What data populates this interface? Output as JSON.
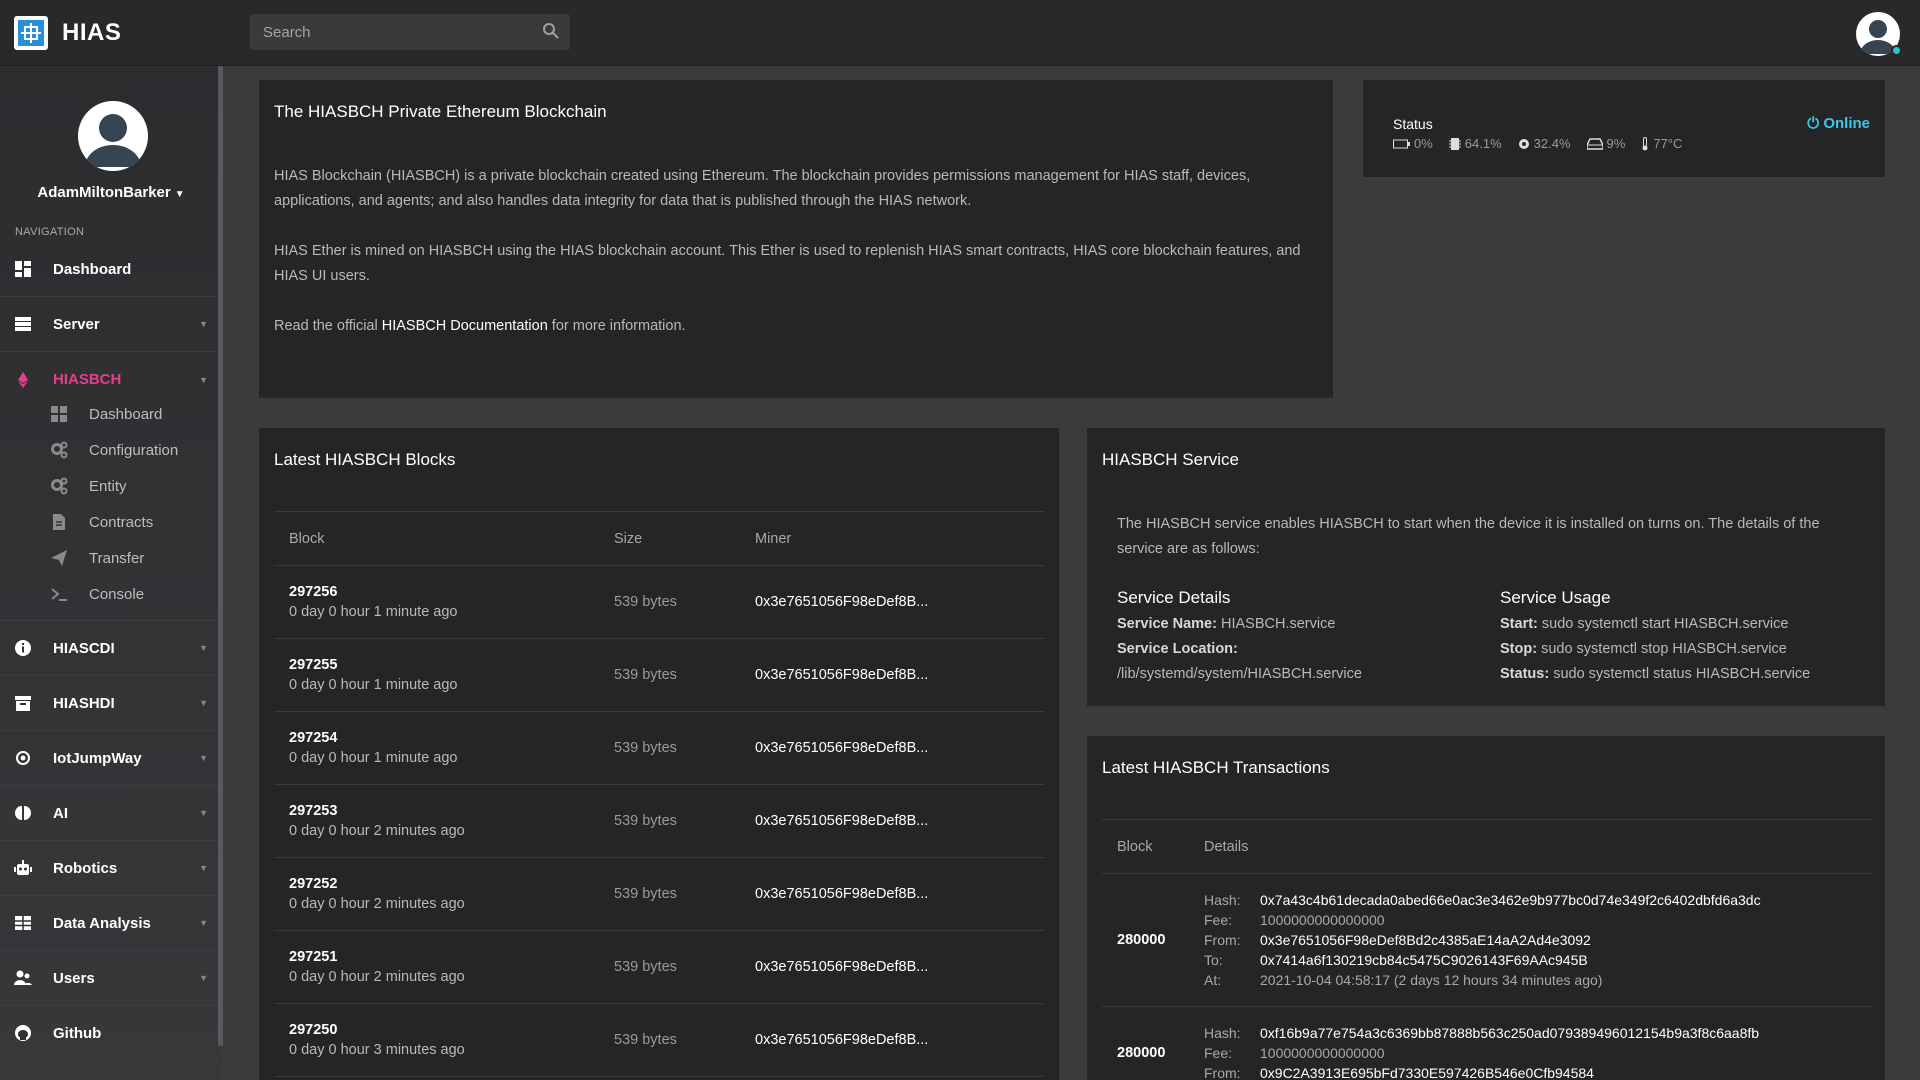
{
  "app": {
    "title": "HIAS"
  },
  "search": {
    "placeholder": "Search"
  },
  "profile": {
    "name": "AdamMiltonBarker"
  },
  "sidebar": {
    "heading": "NAVIGATION",
    "items": [
      {
        "label": "Dashboard",
        "icon": "dashboard-icon"
      },
      {
        "label": "Server",
        "icon": "server-icon"
      },
      {
        "label": "HIASBCH",
        "icon": "ethereum-icon"
      },
      {
        "label": "HIASCDI",
        "icon": "info-icon"
      },
      {
        "label": "HIASHDI",
        "icon": "archive-icon"
      },
      {
        "label": "IotJumpWay",
        "icon": "iot-icon"
      },
      {
        "label": "AI",
        "icon": "brain-icon"
      },
      {
        "label": "Robotics",
        "icon": "robot-icon"
      },
      {
        "label": "Data Analysis",
        "icon": "table-icon"
      },
      {
        "label": "Users",
        "icon": "users-icon"
      },
      {
        "label": "Github",
        "icon": "github-icon"
      }
    ],
    "hiasbch_sub": [
      {
        "label": "Dashboard",
        "icon": "dashboard-icon"
      },
      {
        "label": "Configuration",
        "icon": "cogs-icon"
      },
      {
        "label": "Entity",
        "icon": "cogs-icon"
      },
      {
        "label": "Contracts",
        "icon": "file-icon"
      },
      {
        "label": "Transfer",
        "icon": "send-icon"
      },
      {
        "label": "Console",
        "icon": "terminal-icon"
      }
    ]
  },
  "intro": {
    "title": "The HIASBCH Private Ethereum Blockchain",
    "p1": "HIAS Blockchain (HIASBCH) is a private blockchain created using Ethereum. The blockchain provides permissions management for HIAS staff, devices, applications, and agents; and also handles data integrity for data that is published through the HIAS network.",
    "p2": "HIAS Ether is mined on HIASBCH using the HIAS blockchain account. This Ether is used to replenish HIAS smart contracts, HIAS core blockchain features, and HIAS UI users.",
    "p3_pre": "Read the official ",
    "p3_link": "HIASBCH Documentation",
    "p3_post": " for more information."
  },
  "status": {
    "label": "Status",
    "online": "Online",
    "battery": "0%",
    "cpu": "64.1%",
    "memory": "32.4%",
    "disk": "9%",
    "temp": "77°C"
  },
  "blocks": {
    "title": "Latest HIASBCH Blocks",
    "headers": [
      "Block",
      "Size",
      "Miner"
    ],
    "rows": [
      {
        "block": "297256",
        "ago": "0 day 0 hour 1 minute ago",
        "size": "539 bytes",
        "miner": "0x3e7651056F98eDef8B..."
      },
      {
        "block": "297255",
        "ago": "0 day 0 hour 1 minute ago",
        "size": "539 bytes",
        "miner": "0x3e7651056F98eDef8B..."
      },
      {
        "block": "297254",
        "ago": "0 day 0 hour 1 minute ago",
        "size": "539 bytes",
        "miner": "0x3e7651056F98eDef8B..."
      },
      {
        "block": "297253",
        "ago": "0 day 0 hour 2 minutes ago",
        "size": "539 bytes",
        "miner": "0x3e7651056F98eDef8B..."
      },
      {
        "block": "297252",
        "ago": "0 day 0 hour 2 minutes ago",
        "size": "539 bytes",
        "miner": "0x3e7651056F98eDef8B..."
      },
      {
        "block": "297251",
        "ago": "0 day 0 hour 2 minutes ago",
        "size": "539 bytes",
        "miner": "0x3e7651056F98eDef8B..."
      },
      {
        "block": "297250",
        "ago": "0 day 0 hour 3 minutes ago",
        "size": "539 bytes",
        "miner": "0x3e7651056F98eDef8B..."
      }
    ]
  },
  "service": {
    "title": "HIASBCH Service",
    "desc": "The HIASBCH service enables HIASBCH to start when the device it is installed on turns on. The details of the service are as follows:",
    "details_title": "Service Details",
    "name_key": "Service Name:",
    "name_val": "HIASBCH.service",
    "location_key": "Service Location:",
    "location_val": "/lib/systemd/system/HIASBCH.service",
    "usage_title": "Service Usage",
    "start_key": "Start:",
    "start_val": "sudo systemctl start HIASBCH.service",
    "stop_key": "Stop:",
    "stop_val": "sudo systemctl stop HIASBCH.service",
    "status_key": "Status:",
    "status_val": "sudo systemctl status HIASBCH.service"
  },
  "transactions": {
    "title": "Latest HIASBCH Transactions",
    "headers": [
      "Block",
      "Details"
    ],
    "labels": {
      "hash": "Hash:",
      "fee": "Fee:",
      "from": "From:",
      "to": "To:",
      "at": "At:"
    },
    "rows": [
      {
        "block": "280000",
        "hash": "0x7a43c4b61decada0abed66e0ac3e3462e9b977bc0d74e349f2c6402dbfd6a3dc",
        "fee": "1000000000000000",
        "from": "0x3e7651056F98eDef8Bd2c4385aE14aA2Ad4e3092",
        "to": "0x7414a6f130219cb84c5475C9026143F69AAc945B",
        "at": "2021-10-04 04:58:17 (2 days 12 hours 34 minutes ago)"
      },
      {
        "block": "280000",
        "hash": "0xf16b9a77e754a3c6369bb87888b563c250ad079389496012154b9a3f8c6aa8fb",
        "fee": "1000000000000000",
        "from": "0x9C2A3913E695bFd7330E597426B546e0Cfb94584",
        "to": "",
        "at": ""
      }
    ]
  }
}
